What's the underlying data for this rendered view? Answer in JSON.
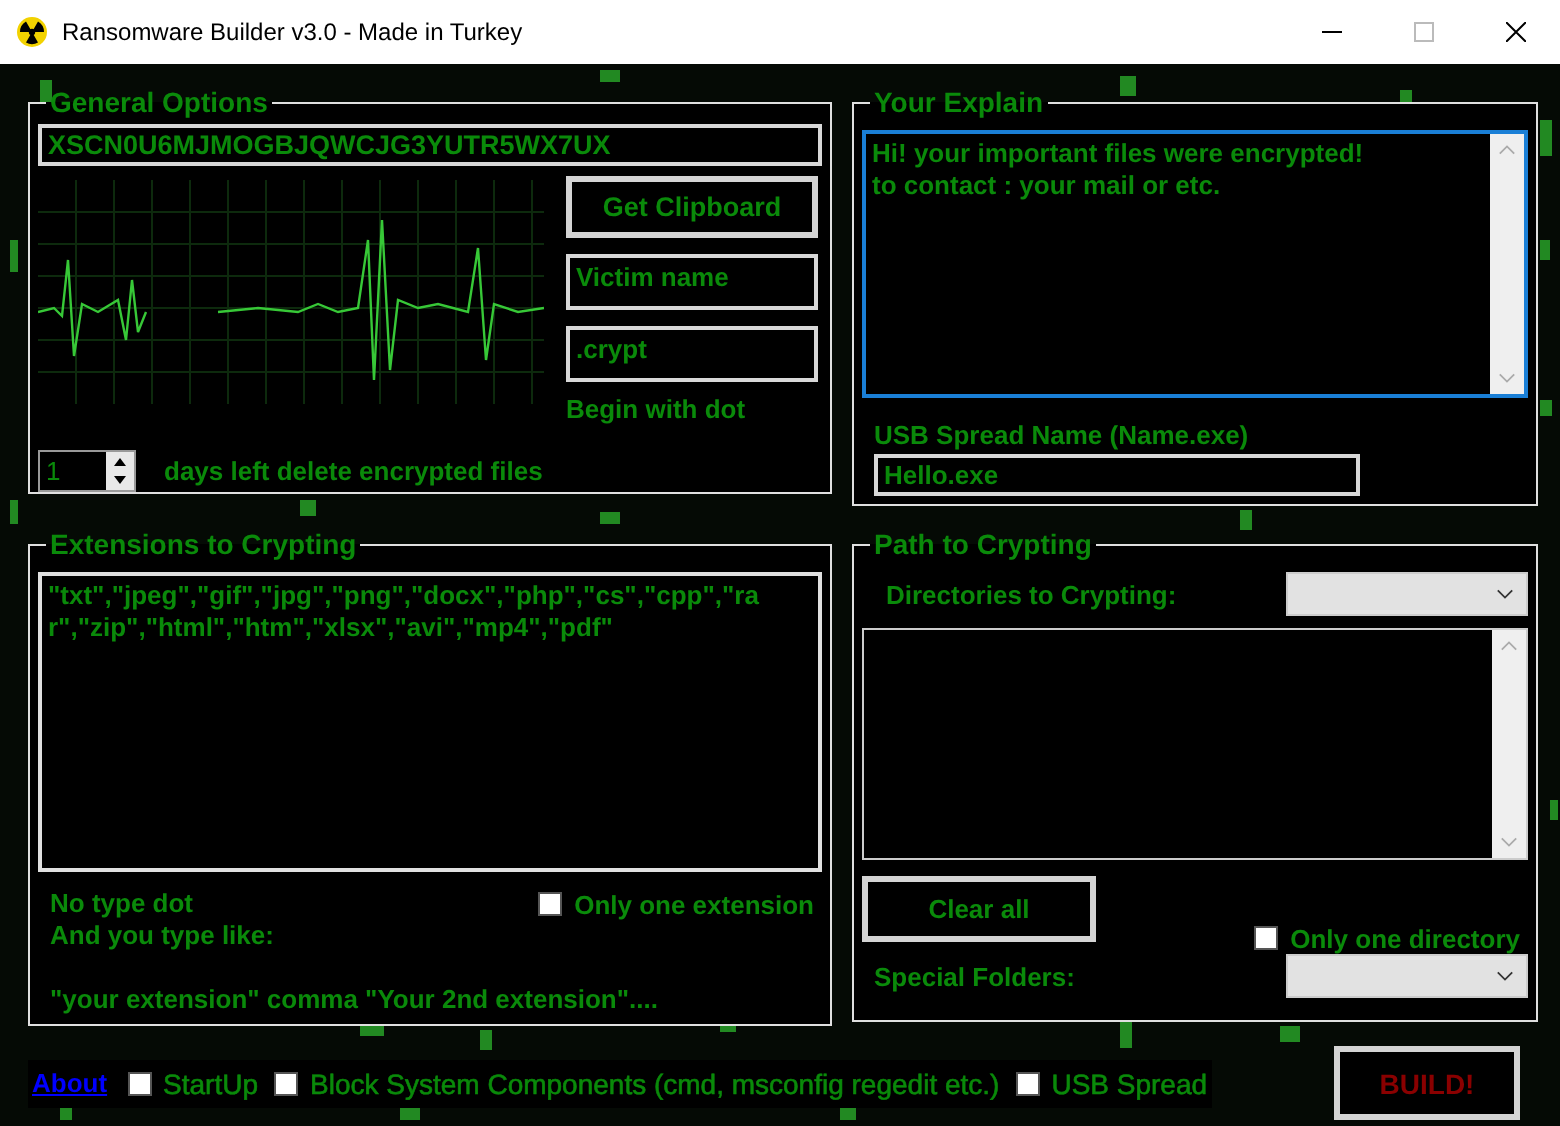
{
  "window": {
    "title": "Ransomware Builder v3.0 - Made in Turkey"
  },
  "general_options": {
    "title": "General Options",
    "key_value": "XSCN0U6MJMOGBJQWCJG3YUTR5WX7UX",
    "get_clipboard_button": "Get Clipboard",
    "victim_name_value": "Victim name",
    "extension_value": ".crypt",
    "extension_hint": "Begin with dot",
    "days_value": "1",
    "days_label": "days left delete encrypted files"
  },
  "your_explain": {
    "title": "Your Explain",
    "message_lines": [
      "Hi! your important files were encrypted!",
      "to contact : your mail or etc."
    ],
    "usb_label": "USB Spread Name (Name.exe)",
    "usb_value": "Hello.exe"
  },
  "extensions": {
    "title": "Extensions to Crypting",
    "value": "\"txt\",\"jpeg\",\"gif\",\"jpg\",\"png\",\"docx\",\"php\",\"cs\",\"cpp\",\"rar\",\"zip\",\"html\",\"htm\",\"xlsx\",\"avi\",\"mp4\",\"pdf\"",
    "hint_lines": [
      "No type dot",
      "And you type like:"
    ],
    "example": "\"your extension\" comma \"Your 2nd extension\"....",
    "only_one": {
      "label": "Only one extension",
      "checked": false
    }
  },
  "path": {
    "title": "Path to Crypting",
    "directories_label": "Directories to Crypting:",
    "clear_button": "Clear all",
    "only_one": {
      "label": "Only one directory",
      "checked": false
    },
    "special_label": "Special Folders:"
  },
  "bottom": {
    "about_link": "About",
    "options": [
      {
        "label": "StartUp",
        "checked": false
      },
      {
        "label": "Block System Components (cmd, msconfig regedit etc.)",
        "checked": false
      },
      {
        "label": "USB Spread",
        "checked": false
      }
    ],
    "build_button": "BUILD!"
  }
}
